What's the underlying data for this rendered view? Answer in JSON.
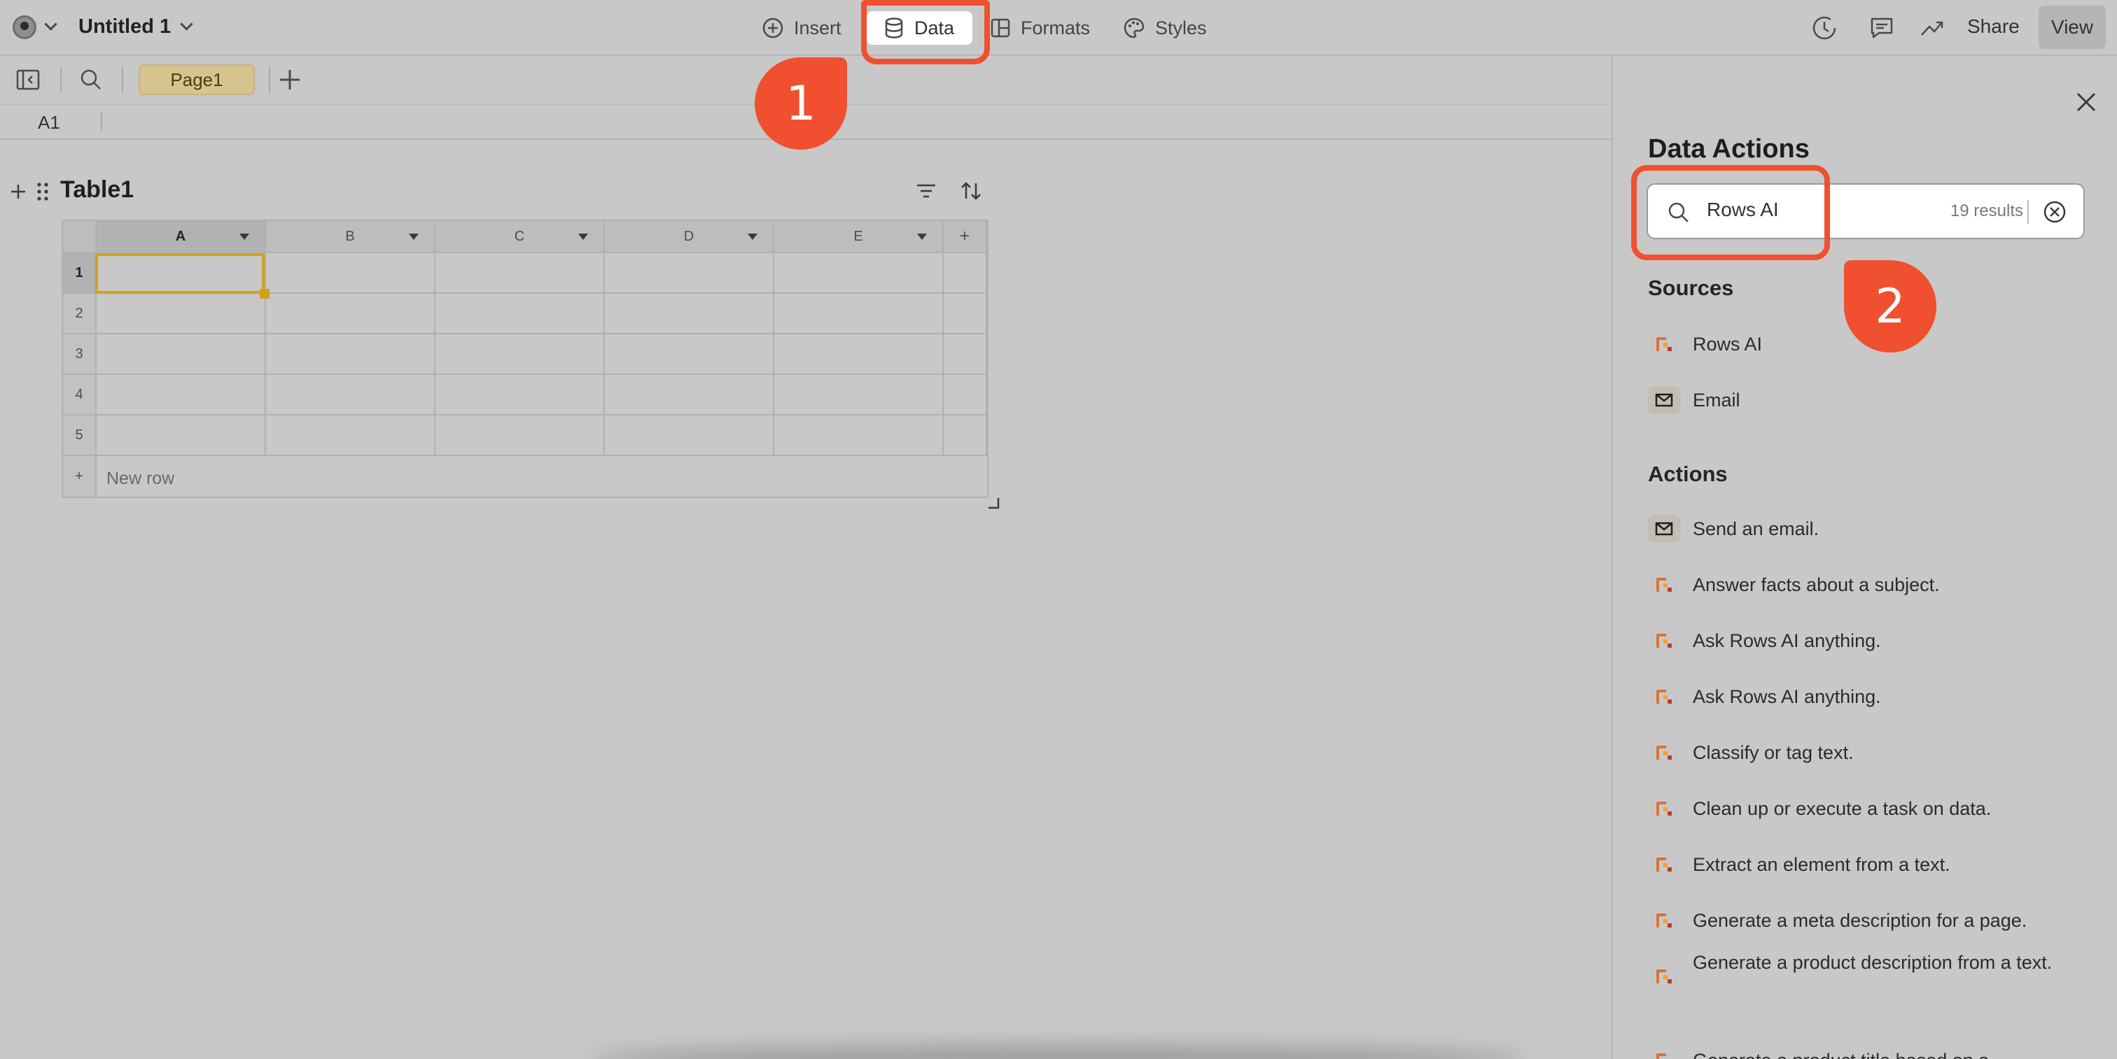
{
  "topbar": {
    "doc_title": "Untitled 1",
    "menu": {
      "insert": "Insert",
      "data": "Data",
      "formats": "Formats",
      "styles": "Styles"
    },
    "share": "Share",
    "view": "View"
  },
  "sheet": {
    "page_tab": "Page1",
    "cell_ref": "A1"
  },
  "table": {
    "title": "Table1",
    "columns": [
      "A",
      "B",
      "C",
      "D",
      "E"
    ],
    "rows": [
      "1",
      "2",
      "3",
      "4",
      "5"
    ],
    "add_column": "+",
    "add_row_symbol": "+",
    "new_row": "New row"
  },
  "panel": {
    "title": "Data Actions",
    "search": {
      "value": "Rows AI",
      "result_count": "19 results"
    },
    "sources_title": "Sources",
    "sources": [
      {
        "label": "Rows AI",
        "icon": "rows-ai-icon"
      },
      {
        "label": "Email",
        "icon": "email-icon"
      }
    ],
    "actions_title": "Actions",
    "actions": [
      {
        "label": "Send an email.",
        "icon": "email-icon"
      },
      {
        "label": "Answer facts about a subject.",
        "icon": "rows-ai-icon"
      },
      {
        "label": "Ask Rows AI anything.",
        "icon": "rows-ai-icon"
      },
      {
        "label": "Ask Rows AI anything.",
        "icon": "rows-ai-icon"
      },
      {
        "label": "Classify or tag text.",
        "icon": "rows-ai-icon"
      },
      {
        "label": "Clean up or execute a task on data.",
        "icon": "rows-ai-icon"
      },
      {
        "label": "Extract an element from a text.",
        "icon": "rows-ai-icon"
      },
      {
        "label": "Generate a meta description for a page.",
        "icon": "rows-ai-icon"
      },
      {
        "label": "Generate a product description from a text.",
        "icon": "rows-ai-icon"
      },
      {
        "label": "Generate a product title based on a",
        "icon": "rows-ai-icon"
      }
    ]
  },
  "callouts": {
    "first": "1",
    "second": "2"
  },
  "colors": {
    "highlight": "#f0502f",
    "selection": "#d2a21a",
    "page_tab": "#d6c48f"
  }
}
